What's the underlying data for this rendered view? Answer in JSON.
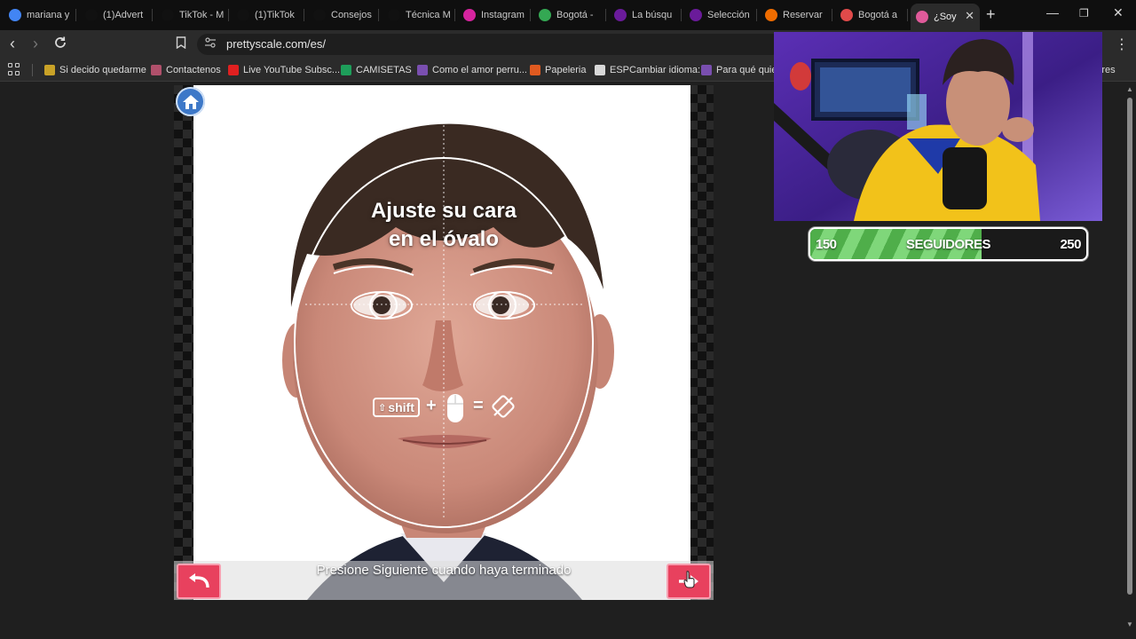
{
  "tabs": [
    {
      "label": "mariana y",
      "favicon": "google-icon",
      "color": "#4285f4"
    },
    {
      "label": "(1)Advert",
      "favicon": "tiktok-icon",
      "color": "#111111"
    },
    {
      "label": "TikTok - M",
      "favicon": "tiktok-icon",
      "color": "#111111"
    },
    {
      "label": "(1)TikTok",
      "favicon": "tiktok-icon",
      "color": "#111111"
    },
    {
      "label": "Consejos",
      "favicon": "tiktok-icon",
      "color": "#111111"
    },
    {
      "label": "Técnica M",
      "favicon": "tiktok-icon",
      "color": "#111111"
    },
    {
      "label": "Instagram",
      "favicon": "instagram-icon",
      "color": "#d6249f"
    },
    {
      "label": "Bogotá -",
      "favicon": "maps-pin-icon",
      "color": "#34a853"
    },
    {
      "label": "La búsqu",
      "favicon": "search-logo-icon",
      "color": "#6a1b9a"
    },
    {
      "label": "Selección",
      "favicon": "search-logo-icon",
      "color": "#6a1b9a"
    },
    {
      "label": "Reservar",
      "favicon": "k-logo-icon",
      "color": "#ef6c00"
    },
    {
      "label": "Bogotá a",
      "favicon": "bus-icon",
      "color": "#e04a4a"
    },
    {
      "label": "¿Soy",
      "favicon": "prettyscale-icon",
      "color": "#e05a9a"
    }
  ],
  "toolbar": {
    "url": "prettyscale.com/es/"
  },
  "bookmarks": [
    {
      "label": "Si decido quedarme",
      "color": "#c9a227"
    },
    {
      "label": "Contactenos",
      "color": "#b0506b"
    },
    {
      "label": "Live YouTube Subsc...",
      "color": "#e02020"
    },
    {
      "label": "CAMISETAS",
      "color": "#1e9e5a"
    },
    {
      "label": "Como el amor perru...",
      "color": "#7a4fb0"
    },
    {
      "label": "Papeleria",
      "color": "#e05a20"
    },
    {
      "label": "ESPCambiar idioma:",
      "color": "#d8d8d8"
    },
    {
      "label": "Para qué quiero",
      "color": "#7a4fb0"
    },
    {
      "label": "adores",
      "color": "#555555"
    }
  ],
  "app": {
    "instruction_line1": "Ajuste su cara",
    "instruction_line2": "en el óvalo",
    "shift_label": "shift",
    "plus": "+",
    "equals": "=",
    "bottom_text": "Presione Siguiente cuando haya terminado"
  },
  "stream": {
    "followers_min": "150",
    "followers_max": "250",
    "followers_label": "SEGUIDORES",
    "followers_progress": 0.62
  },
  "colors": {
    "pink_button": "#e8415e",
    "home_button": "#3d78c8"
  }
}
